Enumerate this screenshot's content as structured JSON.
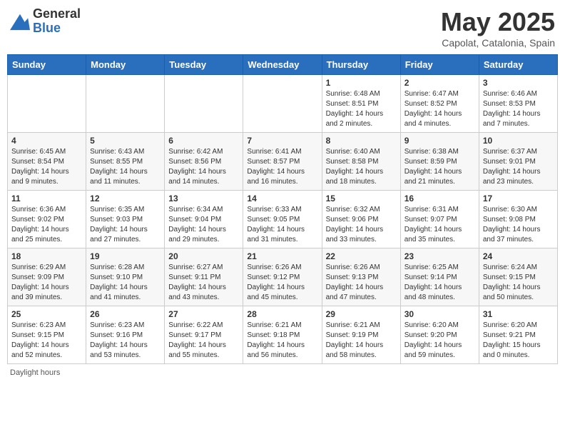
{
  "header": {
    "logo_general": "General",
    "logo_blue": "Blue",
    "month_title": "May 2025",
    "location": "Capolat, Catalonia, Spain"
  },
  "days_of_week": [
    "Sunday",
    "Monday",
    "Tuesday",
    "Wednesday",
    "Thursday",
    "Friday",
    "Saturday"
  ],
  "footer": {
    "daylight_hours": "Daylight hours"
  },
  "weeks": [
    [
      {
        "day": "",
        "info": ""
      },
      {
        "day": "",
        "info": ""
      },
      {
        "day": "",
        "info": ""
      },
      {
        "day": "",
        "info": ""
      },
      {
        "day": "1",
        "info": "Sunrise: 6:48 AM\nSunset: 8:51 PM\nDaylight: 14 hours\nand 2 minutes."
      },
      {
        "day": "2",
        "info": "Sunrise: 6:47 AM\nSunset: 8:52 PM\nDaylight: 14 hours\nand 4 minutes."
      },
      {
        "day": "3",
        "info": "Sunrise: 6:46 AM\nSunset: 8:53 PM\nDaylight: 14 hours\nand 7 minutes."
      }
    ],
    [
      {
        "day": "4",
        "info": "Sunrise: 6:45 AM\nSunset: 8:54 PM\nDaylight: 14 hours\nand 9 minutes."
      },
      {
        "day": "5",
        "info": "Sunrise: 6:43 AM\nSunset: 8:55 PM\nDaylight: 14 hours\nand 11 minutes."
      },
      {
        "day": "6",
        "info": "Sunrise: 6:42 AM\nSunset: 8:56 PM\nDaylight: 14 hours\nand 14 minutes."
      },
      {
        "day": "7",
        "info": "Sunrise: 6:41 AM\nSunset: 8:57 PM\nDaylight: 14 hours\nand 16 minutes."
      },
      {
        "day": "8",
        "info": "Sunrise: 6:40 AM\nSunset: 8:58 PM\nDaylight: 14 hours\nand 18 minutes."
      },
      {
        "day": "9",
        "info": "Sunrise: 6:38 AM\nSunset: 8:59 PM\nDaylight: 14 hours\nand 21 minutes."
      },
      {
        "day": "10",
        "info": "Sunrise: 6:37 AM\nSunset: 9:01 PM\nDaylight: 14 hours\nand 23 minutes."
      }
    ],
    [
      {
        "day": "11",
        "info": "Sunrise: 6:36 AM\nSunset: 9:02 PM\nDaylight: 14 hours\nand 25 minutes."
      },
      {
        "day": "12",
        "info": "Sunrise: 6:35 AM\nSunset: 9:03 PM\nDaylight: 14 hours\nand 27 minutes."
      },
      {
        "day": "13",
        "info": "Sunrise: 6:34 AM\nSunset: 9:04 PM\nDaylight: 14 hours\nand 29 minutes."
      },
      {
        "day": "14",
        "info": "Sunrise: 6:33 AM\nSunset: 9:05 PM\nDaylight: 14 hours\nand 31 minutes."
      },
      {
        "day": "15",
        "info": "Sunrise: 6:32 AM\nSunset: 9:06 PM\nDaylight: 14 hours\nand 33 minutes."
      },
      {
        "day": "16",
        "info": "Sunrise: 6:31 AM\nSunset: 9:07 PM\nDaylight: 14 hours\nand 35 minutes."
      },
      {
        "day": "17",
        "info": "Sunrise: 6:30 AM\nSunset: 9:08 PM\nDaylight: 14 hours\nand 37 minutes."
      }
    ],
    [
      {
        "day": "18",
        "info": "Sunrise: 6:29 AM\nSunset: 9:09 PM\nDaylight: 14 hours\nand 39 minutes."
      },
      {
        "day": "19",
        "info": "Sunrise: 6:28 AM\nSunset: 9:10 PM\nDaylight: 14 hours\nand 41 minutes."
      },
      {
        "day": "20",
        "info": "Sunrise: 6:27 AM\nSunset: 9:11 PM\nDaylight: 14 hours\nand 43 minutes."
      },
      {
        "day": "21",
        "info": "Sunrise: 6:26 AM\nSunset: 9:12 PM\nDaylight: 14 hours\nand 45 minutes."
      },
      {
        "day": "22",
        "info": "Sunrise: 6:26 AM\nSunset: 9:13 PM\nDaylight: 14 hours\nand 47 minutes."
      },
      {
        "day": "23",
        "info": "Sunrise: 6:25 AM\nSunset: 9:14 PM\nDaylight: 14 hours\nand 48 minutes."
      },
      {
        "day": "24",
        "info": "Sunrise: 6:24 AM\nSunset: 9:15 PM\nDaylight: 14 hours\nand 50 minutes."
      }
    ],
    [
      {
        "day": "25",
        "info": "Sunrise: 6:23 AM\nSunset: 9:15 PM\nDaylight: 14 hours\nand 52 minutes."
      },
      {
        "day": "26",
        "info": "Sunrise: 6:23 AM\nSunset: 9:16 PM\nDaylight: 14 hours\nand 53 minutes."
      },
      {
        "day": "27",
        "info": "Sunrise: 6:22 AM\nSunset: 9:17 PM\nDaylight: 14 hours\nand 55 minutes."
      },
      {
        "day": "28",
        "info": "Sunrise: 6:21 AM\nSunset: 9:18 PM\nDaylight: 14 hours\nand 56 minutes."
      },
      {
        "day": "29",
        "info": "Sunrise: 6:21 AM\nSunset: 9:19 PM\nDaylight: 14 hours\nand 58 minutes."
      },
      {
        "day": "30",
        "info": "Sunrise: 6:20 AM\nSunset: 9:20 PM\nDaylight: 14 hours\nand 59 minutes."
      },
      {
        "day": "31",
        "info": "Sunrise: 6:20 AM\nSunset: 9:21 PM\nDaylight: 15 hours\nand 0 minutes."
      }
    ]
  ]
}
